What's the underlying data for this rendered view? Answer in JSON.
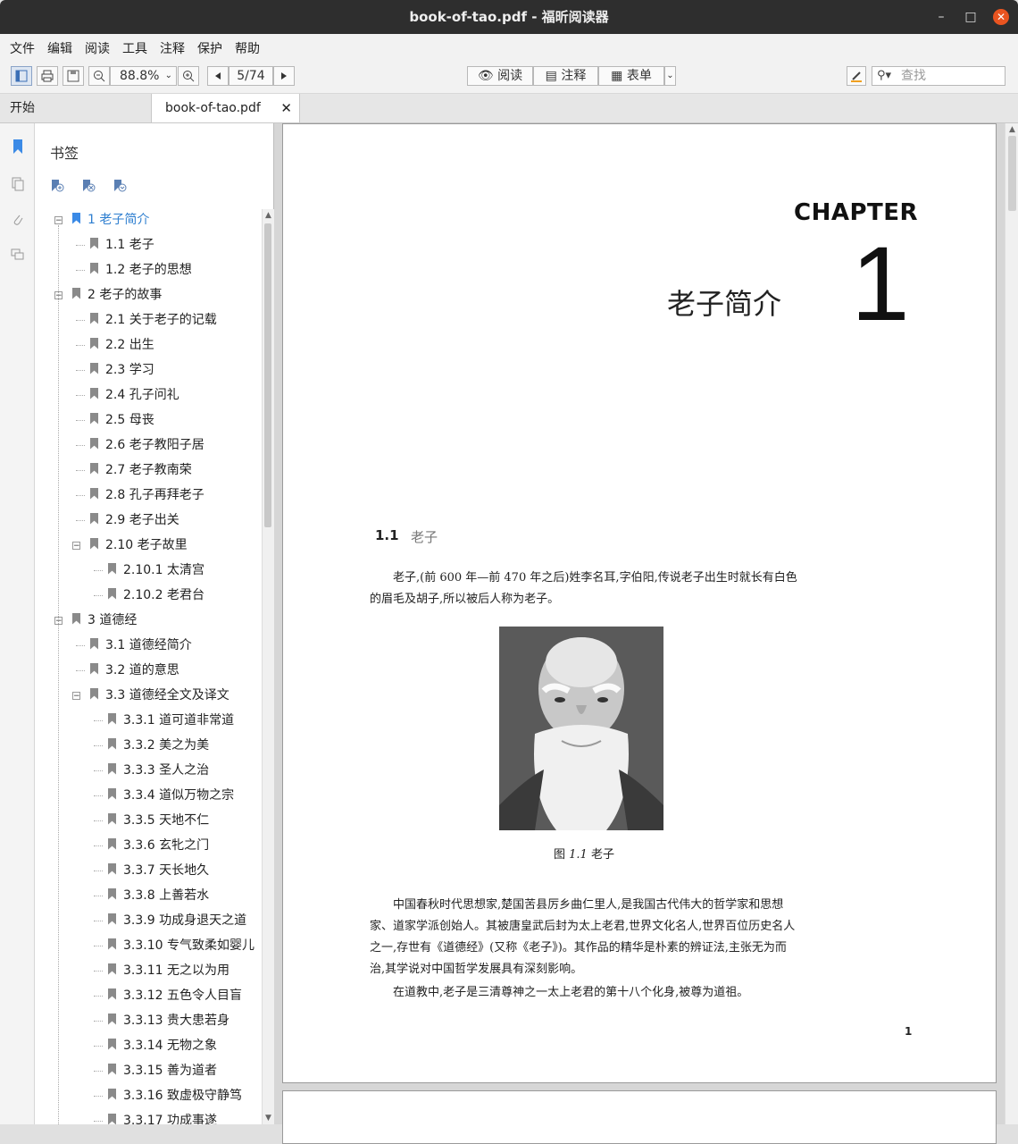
{
  "window": {
    "title": "book-of-tao.pdf - 福昕阅读器",
    "min_glyph": "–",
    "max_glyph": "□",
    "close_glyph": "✕"
  },
  "menu": [
    "文件",
    "编辑",
    "阅读",
    "工具",
    "注释",
    "保护",
    "帮助"
  ],
  "toolbar": {
    "zoom": "88.8%",
    "page": "5/74",
    "read_label": "阅读",
    "annot_label": "注释",
    "form_label": "表单",
    "search_placeholder": "查找"
  },
  "tabs": {
    "home": "开始",
    "doc": "book-of-tao.pdf"
  },
  "bookmarks": {
    "header": "书签",
    "items": [
      {
        "label": "1 老子简介",
        "level": 0,
        "expanded": true,
        "selected": true
      },
      {
        "label": "1.1 老子",
        "level": 1
      },
      {
        "label": "1.2 老子的思想",
        "level": 1
      },
      {
        "label": "2 老子的故事",
        "level": 0,
        "expanded": true
      },
      {
        "label": "2.1 关于老子的记载",
        "level": 1
      },
      {
        "label": "2.2 出生",
        "level": 1
      },
      {
        "label": "2.3 学习",
        "level": 1
      },
      {
        "label": "2.4 孔子问礼",
        "level": 1
      },
      {
        "label": "2.5 母丧",
        "level": 1
      },
      {
        "label": "2.6 老子教阳子居",
        "level": 1
      },
      {
        "label": "2.7 老子教南荣",
        "level": 1
      },
      {
        "label": "2.8 孔子再拜老子",
        "level": 1
      },
      {
        "label": "2.9 老子出关",
        "level": 1
      },
      {
        "label": "2.10 老子故里",
        "level": 1,
        "expanded": true
      },
      {
        "label": "2.10.1 太清宫",
        "level": 2
      },
      {
        "label": "2.10.2 老君台",
        "level": 2
      },
      {
        "label": "3 道德经",
        "level": 0,
        "expanded": true
      },
      {
        "label": "3.1 道德经简介",
        "level": 1
      },
      {
        "label": "3.2 道的意思",
        "level": 1
      },
      {
        "label": "3.3 道德经全文及译文",
        "level": 1,
        "expanded": true
      },
      {
        "label": "3.3.1 道可道非常道",
        "level": 2
      },
      {
        "label": "3.3.2 美之为美",
        "level": 2
      },
      {
        "label": "3.3.3 圣人之治",
        "level": 2
      },
      {
        "label": "3.3.4 道似万物之宗",
        "level": 2
      },
      {
        "label": "3.3.5 天地不仁",
        "level": 2
      },
      {
        "label": "3.3.6 玄牝之门",
        "level": 2
      },
      {
        "label": "3.3.7 天长地久",
        "level": 2
      },
      {
        "label": "3.3.8 上善若水",
        "level": 2
      },
      {
        "label": "3.3.9 功成身退天之道",
        "level": 2
      },
      {
        "label": "3.3.10 专气致柔如婴儿",
        "level": 2
      },
      {
        "label": "3.3.11 无之以为用",
        "level": 2
      },
      {
        "label": "3.3.12 五色令人目盲",
        "level": 2
      },
      {
        "label": "3.3.13 贵大患若身",
        "level": 2
      },
      {
        "label": "3.3.14 无物之象",
        "level": 2
      },
      {
        "label": "3.3.15 善为道者",
        "level": 2
      },
      {
        "label": "3.3.16 致虚极守静笃",
        "level": 2
      },
      {
        "label": "3.3.17 功成事遂",
        "level": 2
      }
    ]
  },
  "page": {
    "chapter_word": "CHAPTER",
    "chapter_num": "1",
    "chapter_title": "老子简介",
    "section_num": "1.1",
    "section_title": "老子",
    "para1": "老子,(前 600 年—前 470 年之后)姓李名耳,字伯阳,传说老子出生时就长有白色的眉毛及胡子,所以被后人称为老子。",
    "caption_prefix": "图 ",
    "caption_num": "1.1",
    "caption_text": " 老子",
    "para2": "中国春秋时代思想家,楚国苦县厉乡曲仁里人,是我国古代伟大的哲学家和思想家、道家学派创始人。其被唐皇武后封为太上老君,世界文化名人,世界百位历史名人之一,存世有《道德经》(又称《老子》)。其作品的精华是朴素的辨证法,主张无为而治,其学说对中国哲学发展具有深刻影响。",
    "para3": "在道教中,老子是三清尊神之一太上老君的第十八个化身,被尊为道祖。",
    "page_number": "1"
  }
}
